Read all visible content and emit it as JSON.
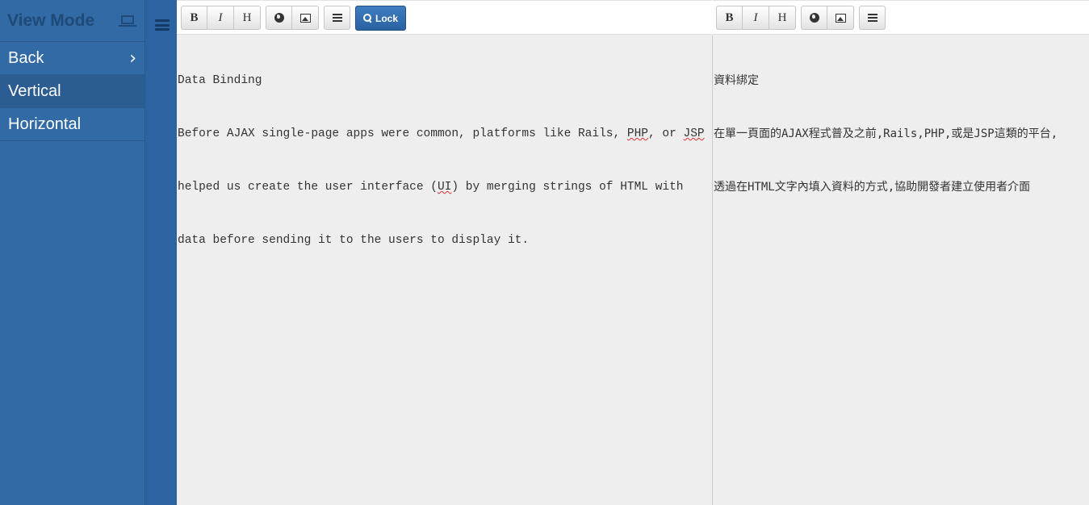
{
  "sidebar": {
    "title": "View Mode",
    "title_icon": "laptop-icon",
    "items": [
      {
        "label": "Back",
        "icon": "chevron-right-icon"
      },
      {
        "label": "Vertical",
        "active": true
      },
      {
        "label": "Horizontal"
      }
    ]
  },
  "toggle": {
    "icon": "hamburger-icon"
  },
  "toolbar": {
    "bold": "B",
    "italic": "I",
    "heading": "H",
    "link_icon": "globe-icon",
    "image_icon": "picture-icon",
    "list_icon": "list-icon",
    "lock_label": "Lock",
    "lock_icon": "search-icon"
  },
  "editor_left": {
    "lines": [
      "Data Binding",
      "Before AJAX single-page apps were common, platforms like Rails, PHP, or JSP",
      "helped us create the user interface (UI) by merging strings of HTML with",
      "data before sending it to the users to display it."
    ]
  },
  "editor_right": {
    "lines": [
      "資料綁定",
      "在單一頁面的AJAX程式普及之前,Rails,PHP,或是JSP這類的平台,",
      "透過在HTML文字內填入資料的方式,協助開發者建立使用者介面"
    ]
  },
  "colors": {
    "sidebar": "#326aa6",
    "strip": "#2c63a0",
    "accent_button": "#2a62a1",
    "editor_bg": "#eeeeee"
  }
}
